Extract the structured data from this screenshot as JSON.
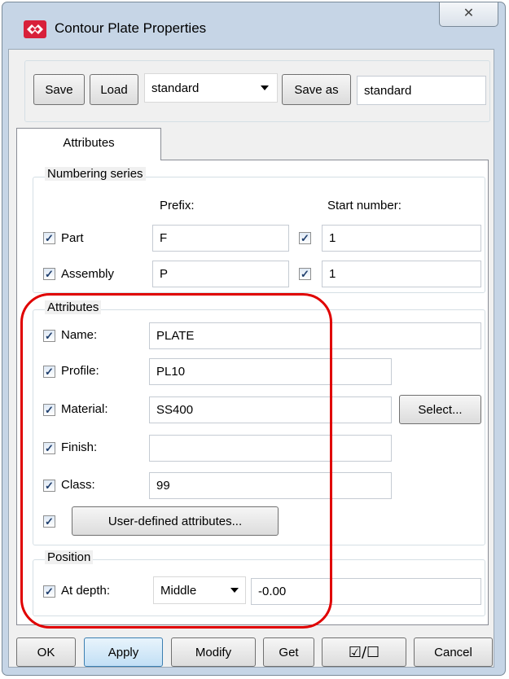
{
  "window": {
    "title": "Contour Plate Properties",
    "close_label": "✕",
    "icon": "tekla-app-icon"
  },
  "toolbar": {
    "save_label": "Save",
    "load_label": "Load",
    "preset_value": "standard",
    "save_as_label": "Save as",
    "save_as_value": "standard"
  },
  "tabs": [
    {
      "label": "Attributes",
      "selected": true
    }
  ],
  "numbering": {
    "legend": "Numbering series",
    "prefix_header": "Prefix:",
    "start_header": "Start number:",
    "rows": [
      {
        "label": "Part",
        "checked": true,
        "prefix": "F",
        "start_checked": true,
        "start": "1"
      },
      {
        "label": "Assembly",
        "checked": true,
        "prefix": "P",
        "start_checked": true,
        "start": "1"
      }
    ]
  },
  "attributes": {
    "legend": "Attributes",
    "name_label": "Name:",
    "name_value": "PLATE",
    "profile_label": "Profile:",
    "profile_value": "PL10",
    "material_label": "Material:",
    "material_value": "SS400",
    "select_label": "Select...",
    "finish_label": "Finish:",
    "finish_value": "",
    "class_label": "Class:",
    "class_value": "99",
    "uda_label": "User-defined attributes..."
  },
  "position": {
    "legend": "Position",
    "depth_label": "At depth:",
    "depth_option": "Middle",
    "depth_value": "-0.00"
  },
  "footer": {
    "ok_label": "OK",
    "apply_label": "Apply",
    "modify_label": "Modify",
    "get_label": "Get",
    "toggle_label": "☑/☐",
    "cancel_label": "Cancel"
  },
  "check_glyph": "✓",
  "colors": {
    "frame": "#c6d5e6",
    "annotation": "#e00000",
    "primary_button": "#c2dff5"
  }
}
